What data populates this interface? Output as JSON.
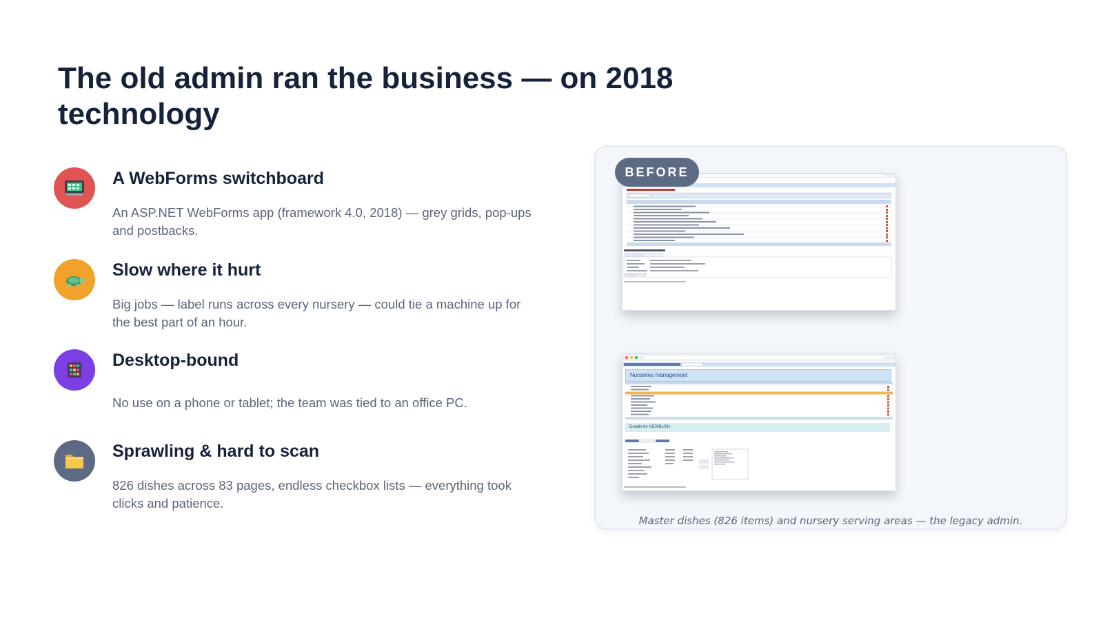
{
  "title": "The old admin ran the business — on 2018 technology",
  "features": [
    {
      "title": "A WebForms switchboard",
      "description": "An ASP.NET WebForms app (framework 4.0, 2018) — grey grids, pop-ups and postbacks.",
      "icon": "computer-icon",
      "color": "#e05454"
    },
    {
      "title": "Slow where it hurt",
      "description": "Big jobs — label runs across every nursery — could tie a machine up for the best part of an hour.",
      "icon": "turtle-icon",
      "color": "#f0a22b"
    },
    {
      "title": "Desktop-bound",
      "description": "No use on a phone or tablet; the team was tied to an office PC.",
      "icon": "abacus-icon",
      "color": "#7b3fe4"
    },
    {
      "title": "Sprawling & hard to scan",
      "description": "826 dishes across 83 pages, endless checkbox lists — everything took clicks and patience.",
      "icon": "folder-icon",
      "color": "#5d6a84"
    }
  ],
  "panel": {
    "badge": "BEFORE",
    "screenshot2_heading": "Nurseries management",
    "screenshot2_subheading": "Details for NEWBUSH",
    "caption": "Master dishes (826 items) and nursery serving areas — the legacy admin."
  }
}
